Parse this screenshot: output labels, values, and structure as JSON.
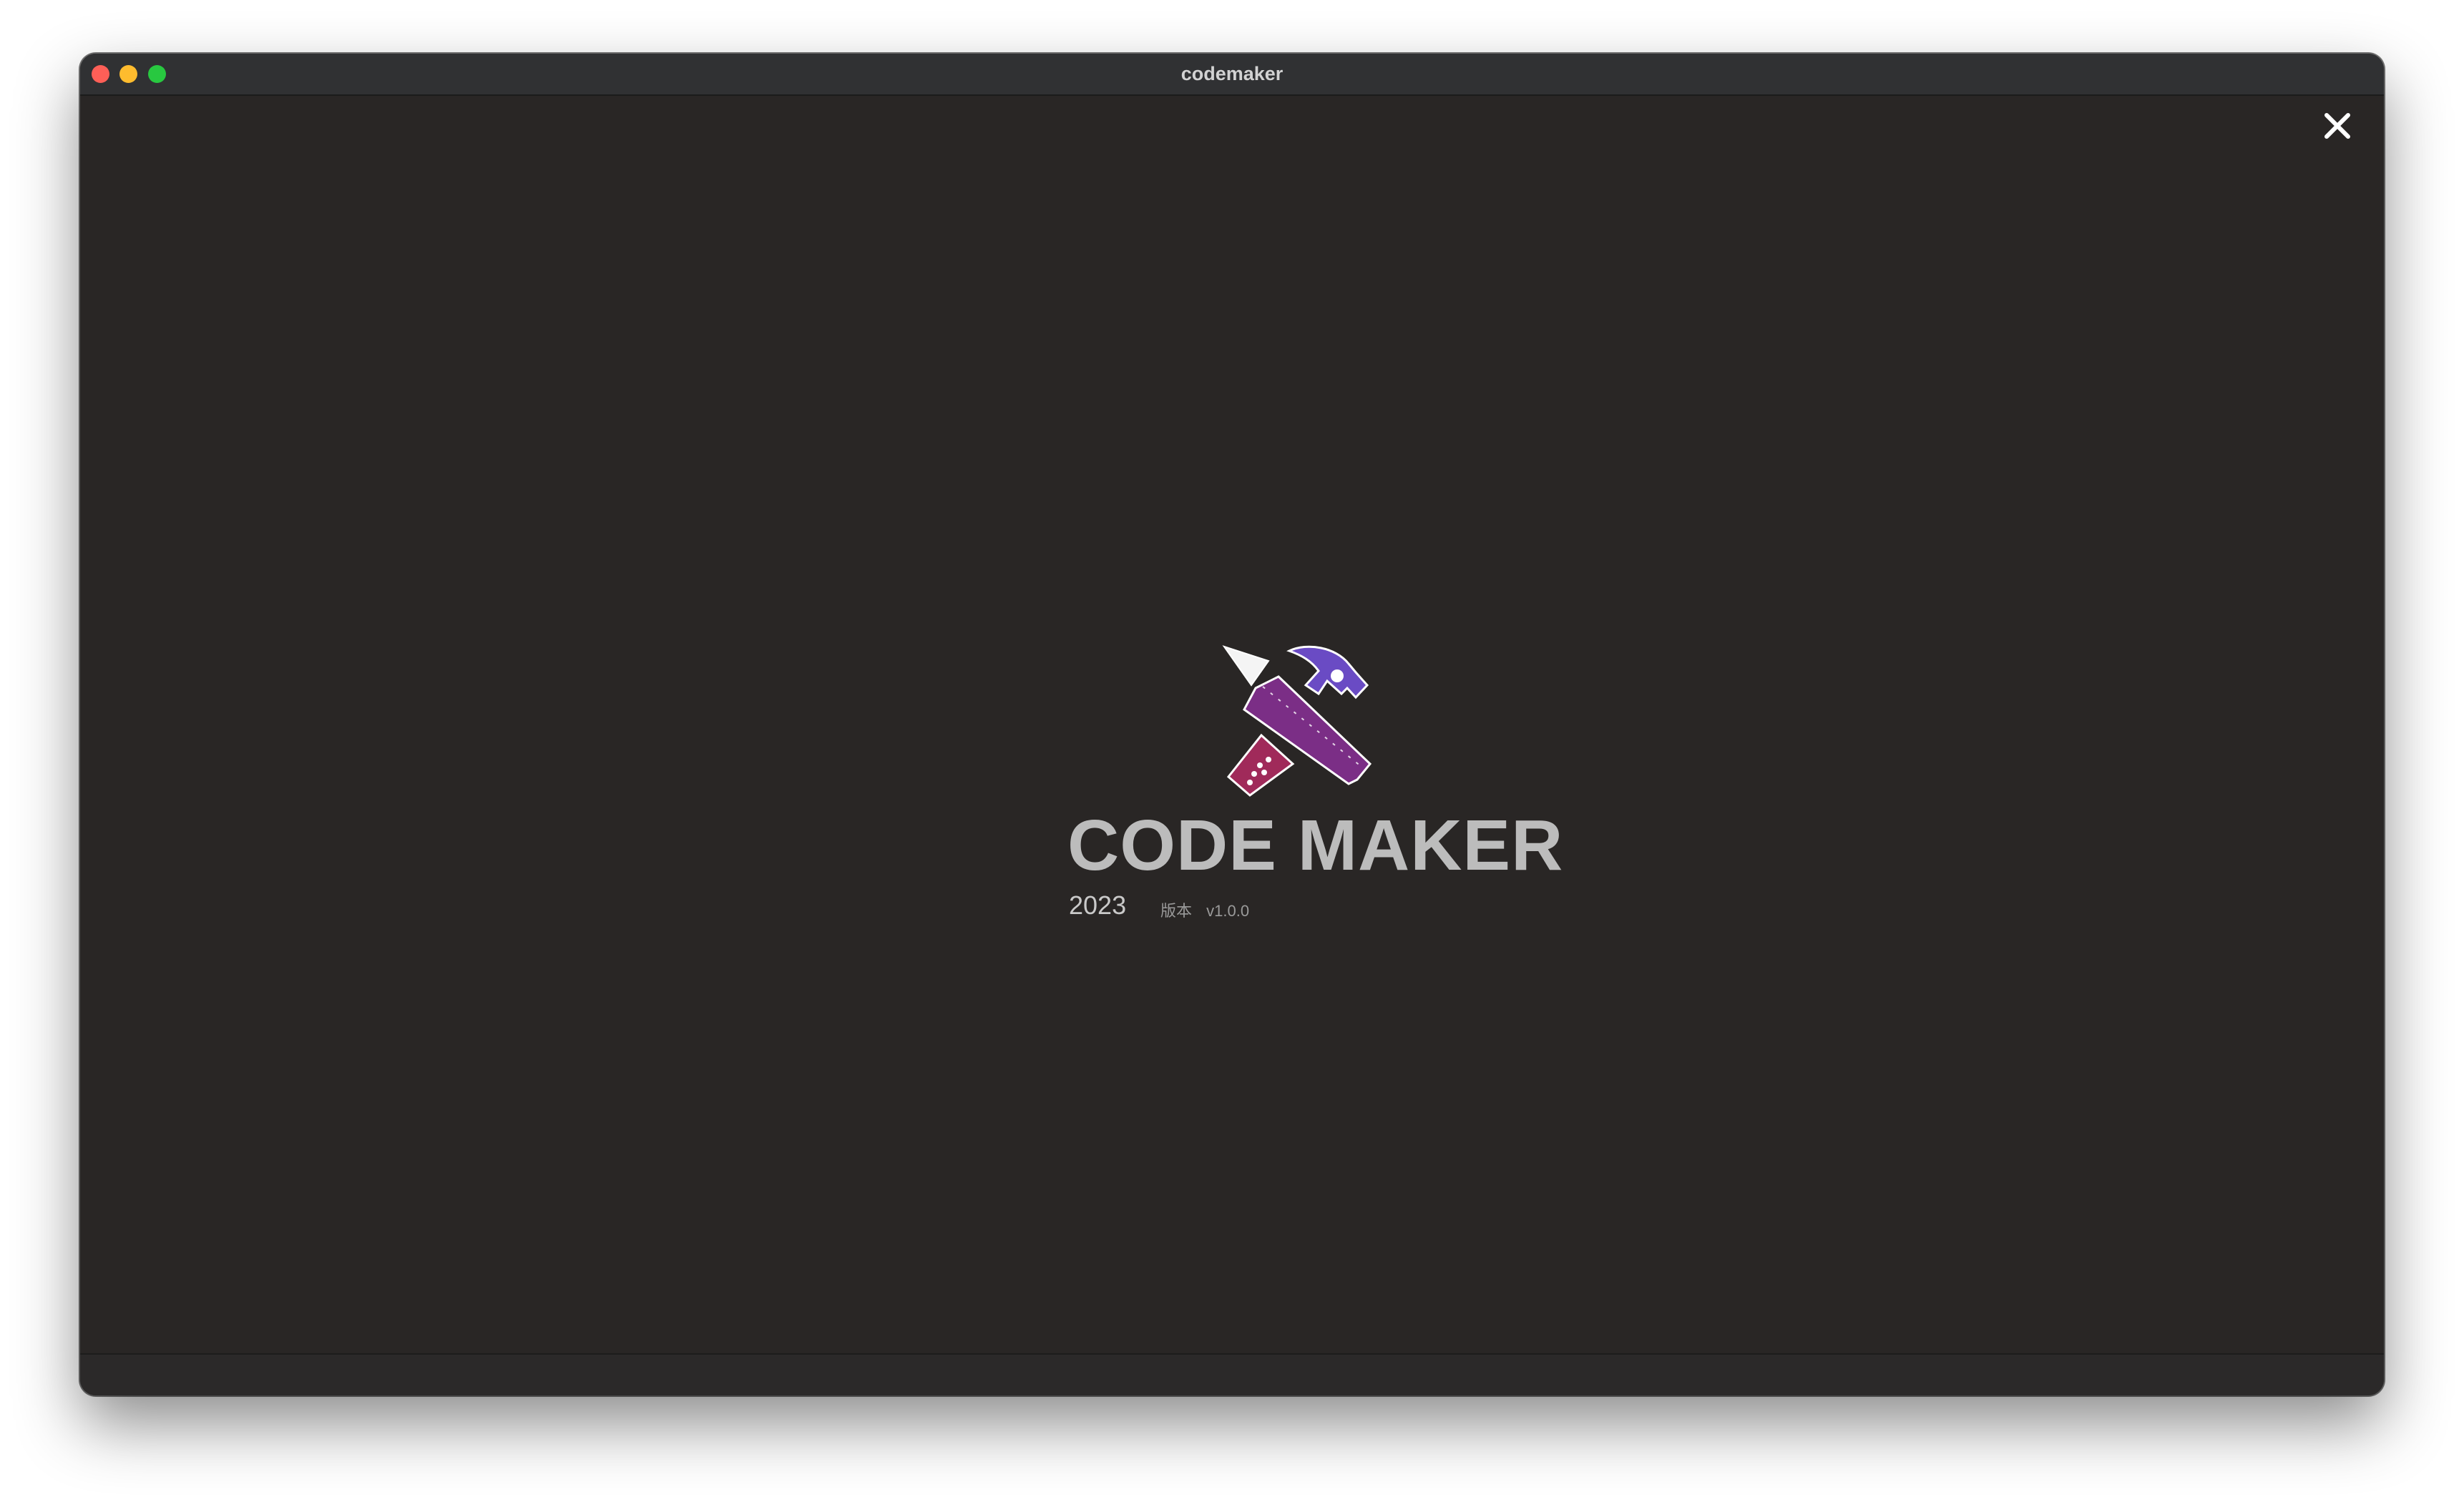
{
  "window": {
    "title": "codemaker"
  },
  "splash": {
    "app_name": "CODE MAKER",
    "year": "2023",
    "version_label": "版本",
    "version": "v1.0.0"
  },
  "icons": {
    "close": "close-icon",
    "logo": "pencil-ruler-hammer-logo"
  },
  "colors": {
    "background": "#292625",
    "ruler": "#7b2e86",
    "ruler_tip": "#a02a5a",
    "hammer": "#6a4bc4"
  }
}
